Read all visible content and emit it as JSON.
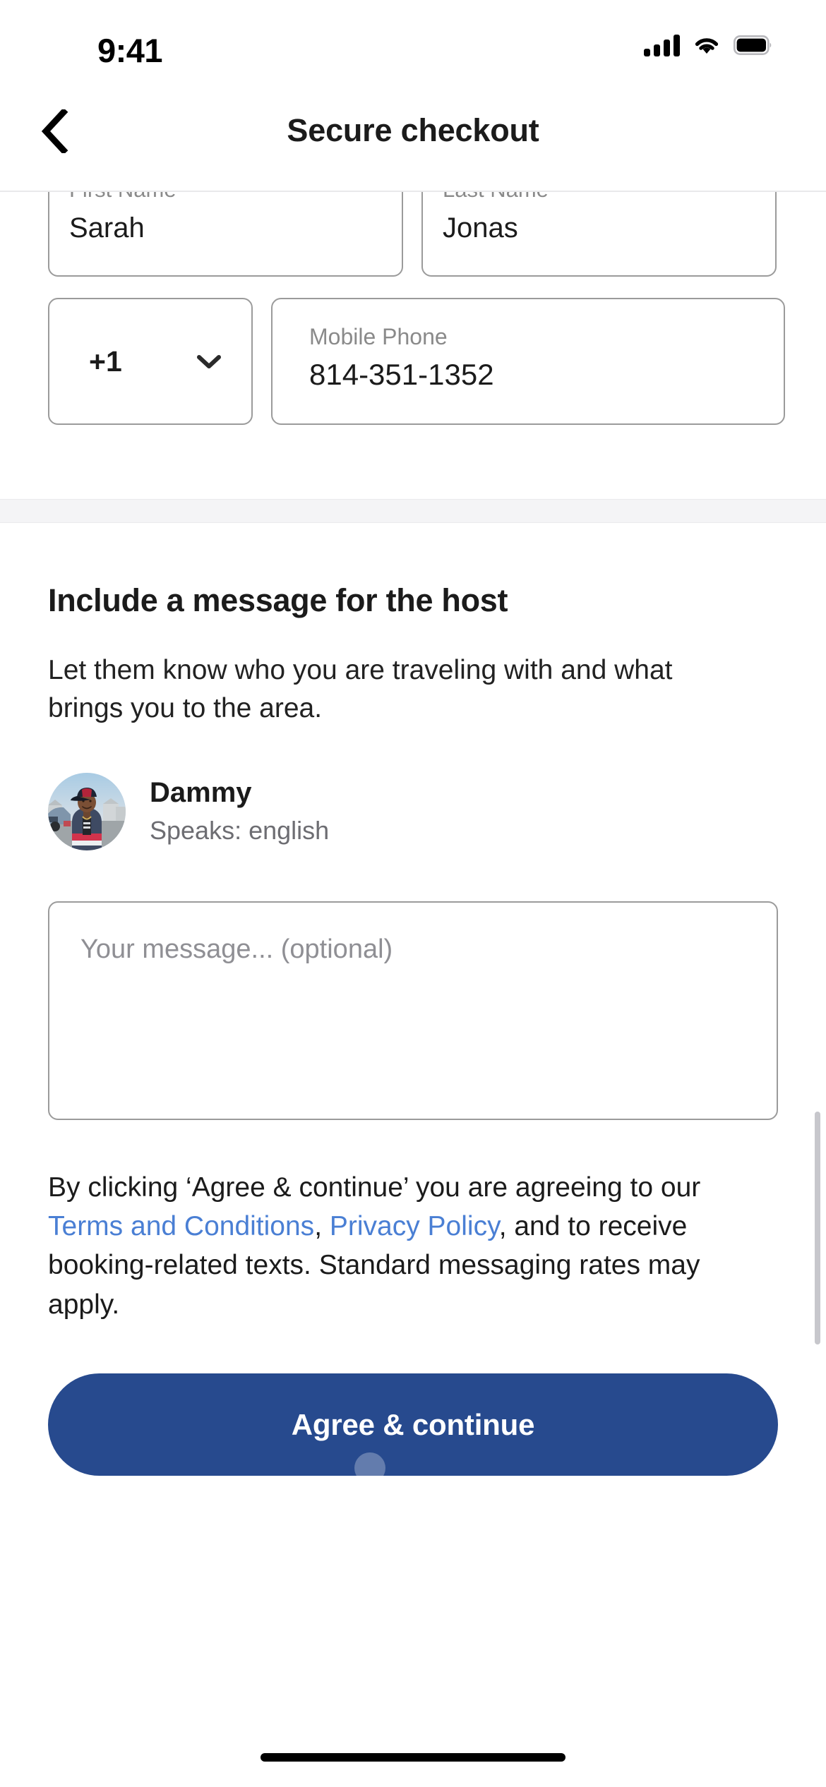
{
  "status_bar": {
    "time": "9:41",
    "signal_icon": "cellular-signal-icon",
    "wifi_icon": "wifi-icon",
    "battery_icon": "battery-full-icon"
  },
  "header": {
    "back_icon": "chevron-left-icon",
    "title": "Secure checkout"
  },
  "form": {
    "first_name": {
      "label": "First Name",
      "value": "Sarah"
    },
    "last_name": {
      "label": "Last Name",
      "value": "Jonas"
    },
    "country_code": {
      "value": "+1",
      "chevron_icon": "chevron-down-icon"
    },
    "mobile_phone": {
      "label": "Mobile Phone",
      "value": "814-351-1352"
    }
  },
  "message_section": {
    "heading": "Include a message for the host",
    "description": "Let them know who you are traveling with and what brings you to the area.",
    "host": {
      "avatar_icon": "host-avatar-photo",
      "name": "Dammy",
      "speaks": "Speaks: english"
    },
    "textarea_placeholder": "Your message... (optional)",
    "textarea_value": ""
  },
  "legal": {
    "part1": "By clicking ‘Agree & continue’ you are agreeing to our ",
    "link_terms": "Terms and Conditions",
    "separator": ", ",
    "link_privacy": "Privacy Policy",
    "part2": ", and to receive booking-related texts. Standard messaging rates may apply."
  },
  "cta": {
    "label": "Agree & continue"
  },
  "colors": {
    "primary_button": "#274a8e",
    "link": "#4a7fd4",
    "border": "#9b9b9b",
    "placeholder": "#8f8f94",
    "band": "#f4f4f6"
  }
}
